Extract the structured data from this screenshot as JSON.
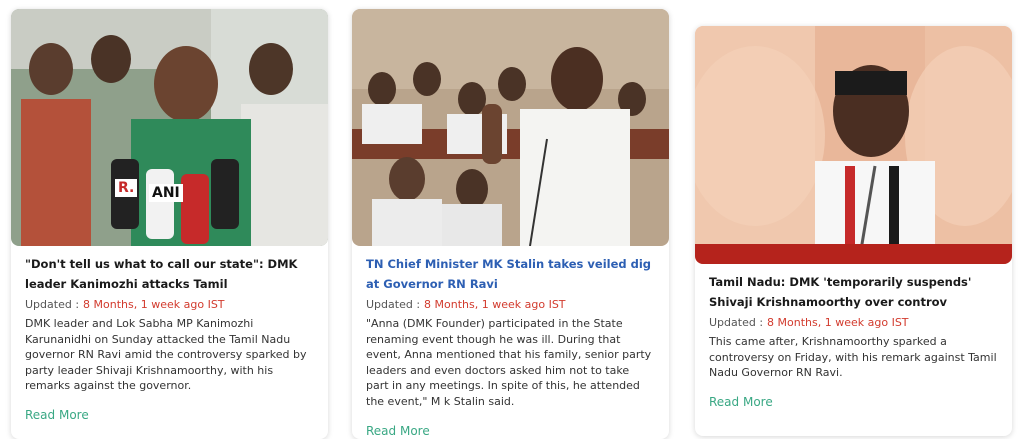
{
  "cards": [
    {
      "image_alt": "Kanimozhi speaking to media microphones",
      "mic_labels": [
        "R.",
        "ANI"
      ],
      "title": "\"Don't tell us what to call our state\": DMK leader Kanimozhi attacks Tamil",
      "updated_label": "Updated :",
      "updated_ago": "8 Months, 1 week ago IST",
      "summary": "DMK leader and Lok Sabha MP Kanimozhi Karunanidhi on Sunday attacked the Tamil Nadu governor RN Ravi amid the controversy sparked by party leader Shivaji Krishnamoorthy, with his remarks against the governor.",
      "read_more": "Read More"
    },
    {
      "image_alt": "MK Stalin speaking in the Assembly",
      "title": "TN Chief Minister MK Stalin takes veiled dig at Governor RN Ravi",
      "updated_label": "Updated :",
      "updated_ago": "8 Months, 1 week ago IST",
      "summary": "\"Anna (DMK Founder) participated in the State renaming event though he was ill. During that event, Anna mentioned that his family, senior party leaders and even doctors asked him not to take part in any meetings. In spite of this, he attended the event,\" M k Stalin said.",
      "read_more": "Read More"
    },
    {
      "image_alt": "Shivaji Krishnamoorthy speaking at a microphone",
      "title": "Tamil Nadu: DMK 'temporarily suspends' Shivaji Krishnamoorthy over controv",
      "updated_label": "Updated :",
      "updated_ago": "8 Months, 1 week ago IST",
      "summary": "This came after, Krishnamoorthy sparked a controversy on Friday, with his remark against Tamil Nadu Governor RN Ravi.",
      "read_more": "Read More"
    }
  ],
  "colors": {
    "title": "#1a1a1a",
    "title_link": "#2d5fb3",
    "updated_ago": "#d23b2e",
    "read_more": "#3aa884"
  }
}
